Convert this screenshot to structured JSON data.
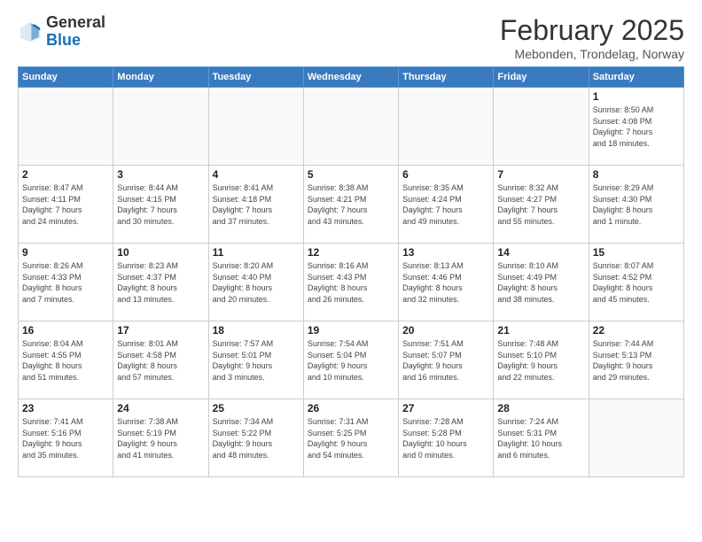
{
  "logo": {
    "general": "General",
    "blue": "Blue"
  },
  "title": "February 2025",
  "subtitle": "Mebonden, Trondelag, Norway",
  "days_of_week": [
    "Sunday",
    "Monday",
    "Tuesday",
    "Wednesday",
    "Thursday",
    "Friday",
    "Saturday"
  ],
  "weeks": [
    [
      {
        "day": "",
        "info": ""
      },
      {
        "day": "",
        "info": ""
      },
      {
        "day": "",
        "info": ""
      },
      {
        "day": "",
        "info": ""
      },
      {
        "day": "",
        "info": ""
      },
      {
        "day": "",
        "info": ""
      },
      {
        "day": "1",
        "info": "Sunrise: 8:50 AM\nSunset: 4:08 PM\nDaylight: 7 hours\nand 18 minutes."
      }
    ],
    [
      {
        "day": "2",
        "info": "Sunrise: 8:47 AM\nSunset: 4:11 PM\nDaylight: 7 hours\nand 24 minutes."
      },
      {
        "day": "3",
        "info": "Sunrise: 8:44 AM\nSunset: 4:15 PM\nDaylight: 7 hours\nand 30 minutes."
      },
      {
        "day": "4",
        "info": "Sunrise: 8:41 AM\nSunset: 4:18 PM\nDaylight: 7 hours\nand 37 minutes."
      },
      {
        "day": "5",
        "info": "Sunrise: 8:38 AM\nSunset: 4:21 PM\nDaylight: 7 hours\nand 43 minutes."
      },
      {
        "day": "6",
        "info": "Sunrise: 8:35 AM\nSunset: 4:24 PM\nDaylight: 7 hours\nand 49 minutes."
      },
      {
        "day": "7",
        "info": "Sunrise: 8:32 AM\nSunset: 4:27 PM\nDaylight: 7 hours\nand 55 minutes."
      },
      {
        "day": "8",
        "info": "Sunrise: 8:29 AM\nSunset: 4:30 PM\nDaylight: 8 hours\nand 1 minute."
      }
    ],
    [
      {
        "day": "9",
        "info": "Sunrise: 8:26 AM\nSunset: 4:33 PM\nDaylight: 8 hours\nand 7 minutes."
      },
      {
        "day": "10",
        "info": "Sunrise: 8:23 AM\nSunset: 4:37 PM\nDaylight: 8 hours\nand 13 minutes."
      },
      {
        "day": "11",
        "info": "Sunrise: 8:20 AM\nSunset: 4:40 PM\nDaylight: 8 hours\nand 20 minutes."
      },
      {
        "day": "12",
        "info": "Sunrise: 8:16 AM\nSunset: 4:43 PM\nDaylight: 8 hours\nand 26 minutes."
      },
      {
        "day": "13",
        "info": "Sunrise: 8:13 AM\nSunset: 4:46 PM\nDaylight: 8 hours\nand 32 minutes."
      },
      {
        "day": "14",
        "info": "Sunrise: 8:10 AM\nSunset: 4:49 PM\nDaylight: 8 hours\nand 38 minutes."
      },
      {
        "day": "15",
        "info": "Sunrise: 8:07 AM\nSunset: 4:52 PM\nDaylight: 8 hours\nand 45 minutes."
      }
    ],
    [
      {
        "day": "16",
        "info": "Sunrise: 8:04 AM\nSunset: 4:55 PM\nDaylight: 8 hours\nand 51 minutes."
      },
      {
        "day": "17",
        "info": "Sunrise: 8:01 AM\nSunset: 4:58 PM\nDaylight: 8 hours\nand 57 minutes."
      },
      {
        "day": "18",
        "info": "Sunrise: 7:57 AM\nSunset: 5:01 PM\nDaylight: 9 hours\nand 3 minutes."
      },
      {
        "day": "19",
        "info": "Sunrise: 7:54 AM\nSunset: 5:04 PM\nDaylight: 9 hours\nand 10 minutes."
      },
      {
        "day": "20",
        "info": "Sunrise: 7:51 AM\nSunset: 5:07 PM\nDaylight: 9 hours\nand 16 minutes."
      },
      {
        "day": "21",
        "info": "Sunrise: 7:48 AM\nSunset: 5:10 PM\nDaylight: 9 hours\nand 22 minutes."
      },
      {
        "day": "22",
        "info": "Sunrise: 7:44 AM\nSunset: 5:13 PM\nDaylight: 9 hours\nand 29 minutes."
      }
    ],
    [
      {
        "day": "23",
        "info": "Sunrise: 7:41 AM\nSunset: 5:16 PM\nDaylight: 9 hours\nand 35 minutes."
      },
      {
        "day": "24",
        "info": "Sunrise: 7:38 AM\nSunset: 5:19 PM\nDaylight: 9 hours\nand 41 minutes."
      },
      {
        "day": "25",
        "info": "Sunrise: 7:34 AM\nSunset: 5:22 PM\nDaylight: 9 hours\nand 48 minutes."
      },
      {
        "day": "26",
        "info": "Sunrise: 7:31 AM\nSunset: 5:25 PM\nDaylight: 9 hours\nand 54 minutes."
      },
      {
        "day": "27",
        "info": "Sunrise: 7:28 AM\nSunset: 5:28 PM\nDaylight: 10 hours\nand 0 minutes."
      },
      {
        "day": "28",
        "info": "Sunrise: 7:24 AM\nSunset: 5:31 PM\nDaylight: 10 hours\nand 6 minutes."
      },
      {
        "day": "",
        "info": ""
      }
    ]
  ]
}
